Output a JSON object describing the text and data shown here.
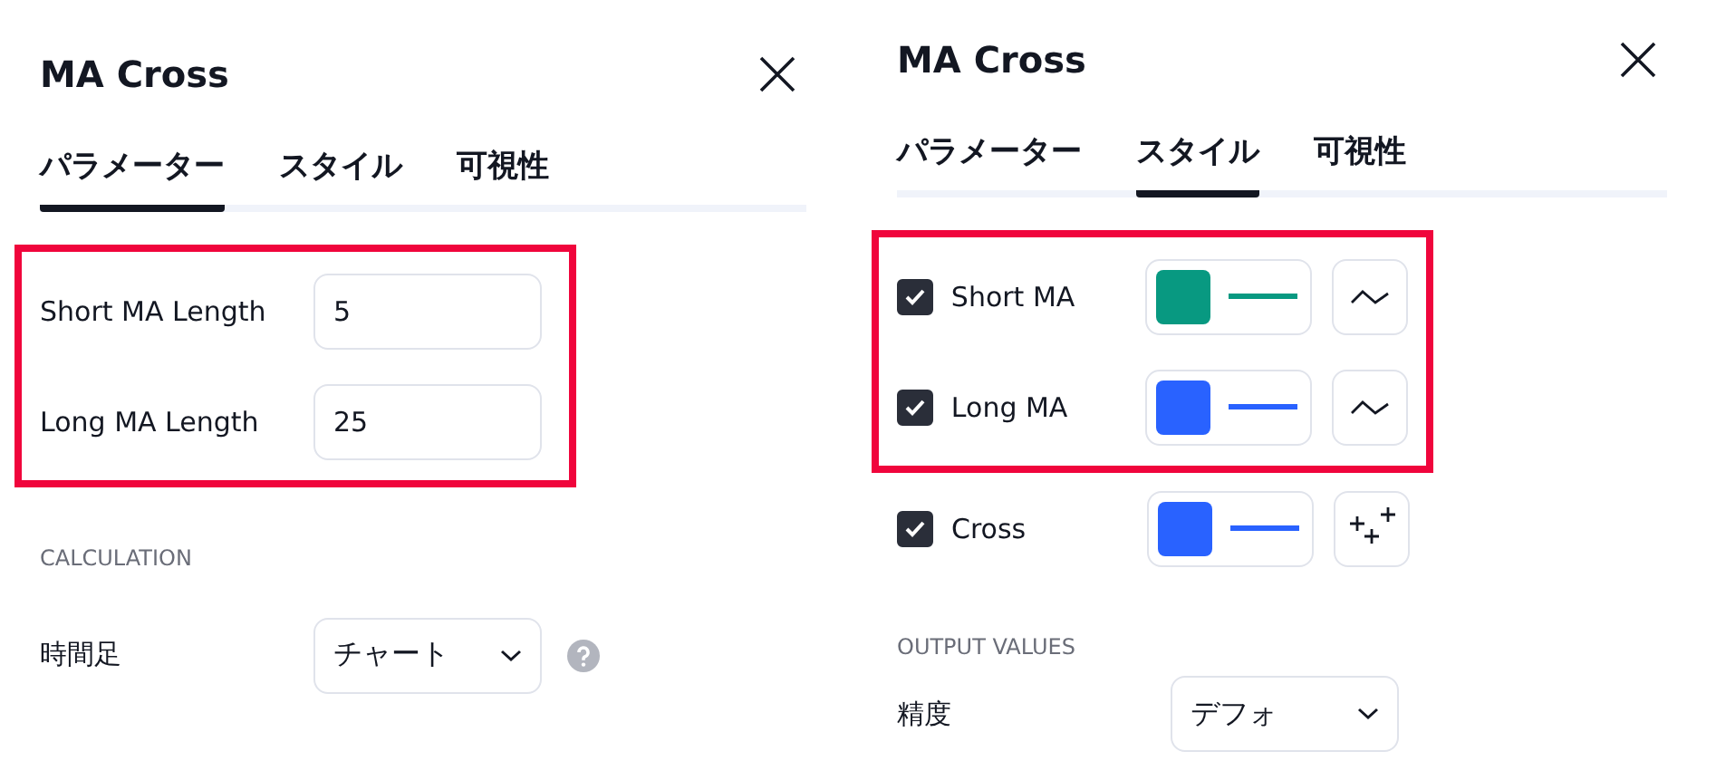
{
  "panels": [
    {
      "title": "MA Cross",
      "tabs": [
        {
          "label": "パラメーター",
          "selected": true
        },
        {
          "label": "スタイル",
          "selected": false
        },
        {
          "label": "可視性",
          "selected": false
        }
      ],
      "highlighted_rows": [
        {
          "kind": "number",
          "label": "Short MA Length",
          "value": "5"
        },
        {
          "kind": "number",
          "label": "Long MA Length",
          "value": "25"
        }
      ],
      "rows": [
        {
          "kind": "heading",
          "label": "CALCULATION"
        },
        {
          "kind": "select",
          "label": "時間足",
          "value": "チャート",
          "help": true
        }
      ]
    },
    {
      "title": "MA Cross",
      "tabs": [
        {
          "label": "パラメーター",
          "selected": false
        },
        {
          "label": "スタイル",
          "selected": true
        },
        {
          "label": "可視性",
          "selected": false
        }
      ],
      "highlighted_rows": [
        {
          "kind": "plot",
          "label": "Short MA",
          "checked": true,
          "color": "#089981",
          "style_button": {
            "kind": "line"
          }
        },
        {
          "kind": "plot",
          "label": "Long MA",
          "checked": true,
          "color": "#2962ff",
          "style_button": {
            "kind": "line"
          }
        }
      ],
      "rows": [
        {
          "kind": "plot",
          "label": "Cross",
          "checked": true,
          "color": "#2962ff",
          "style_button": {
            "kind": "cross"
          }
        },
        {
          "kind": "heading",
          "label": "OUTPUT VALUES"
        },
        {
          "kind": "select",
          "label": "精度",
          "value": "デフォ",
          "help": false
        }
      ]
    }
  ]
}
